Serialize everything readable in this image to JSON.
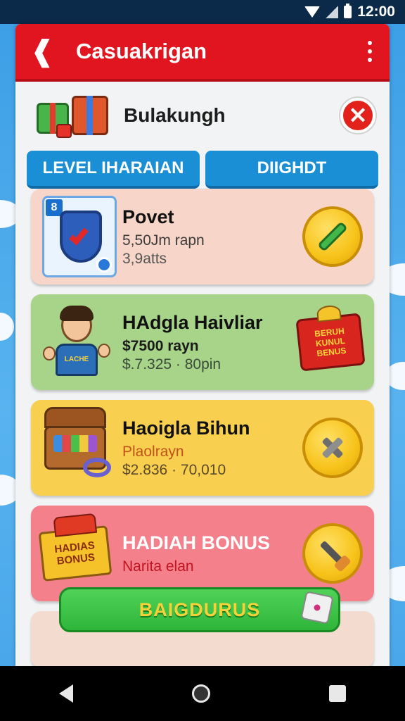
{
  "status_bar": {
    "time": "12:00"
  },
  "header": {
    "title": "Casuakrigan",
    "back_icon": "back-arrow-icon",
    "more_icon": "more-vertical-icon"
  },
  "subheader": {
    "title": "Bulakungh"
  },
  "tabs": [
    {
      "label": "LEVEL IHARAIAN"
    },
    {
      "label": "DIIGHDT"
    }
  ],
  "cards": [
    {
      "name": "Povet",
      "line1": "5,50Jm rapn",
      "line2": "3,9atts",
      "color": "#f7d5c8",
      "action_icon": "pencil-icon",
      "thumb_icon": "shield-icon"
    },
    {
      "name": "HAdgla Haivliar",
      "line1": "$7500 rayn",
      "line2": "$.7.325 · 80pin",
      "color": "#a8d48a",
      "action_icon": "bonus-gift-icon",
      "thumb_icon": "avatar-icon",
      "badge_text": "BERUH KUNUL BENUS",
      "shirt_text": "LACHE"
    },
    {
      "name": "Haoigla Bihun",
      "line1": "Plaolrayn",
      "line2": "$2.836 · 70,010",
      "color": "#f8cf4f",
      "action_icon": "hammer-icon",
      "thumb_icon": "treasure-chest-icon"
    },
    {
      "name": "HADIAH BONUS",
      "line1": "Narita elan",
      "line2": "",
      "color": "#f4808c",
      "action_icon": "tool-icon",
      "thumb_icon": "bonus-gift-icon",
      "badge_text": "HADIAS BONUS"
    }
  ],
  "primary_button": {
    "label": "BAIGDURUS"
  },
  "colors": {
    "header_red": "#e0151f",
    "tab_blue": "#1a8fd6",
    "button_green": "#2fb53a",
    "gold": "#f7c31a"
  }
}
